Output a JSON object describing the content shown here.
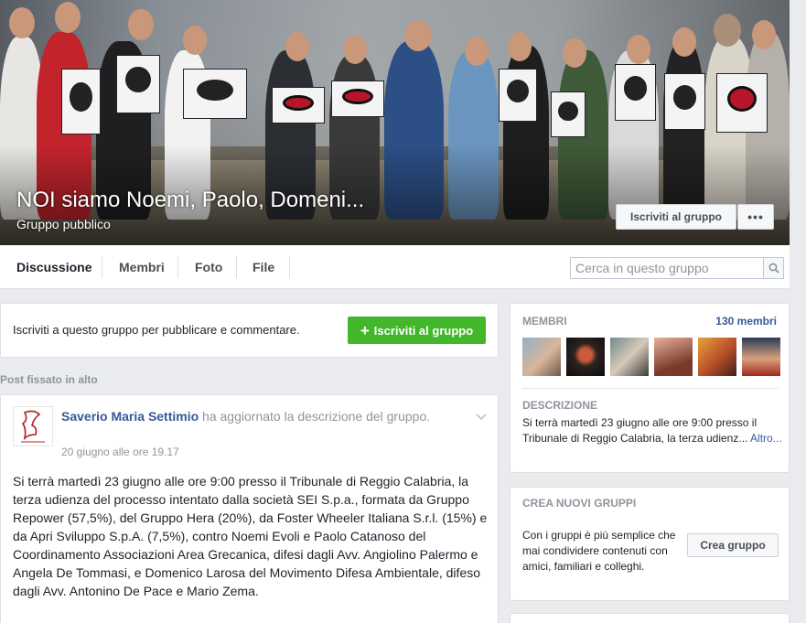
{
  "group": {
    "title": "NOI siamo Noemi, Paolo, Domeni...",
    "privacy": "Gruppo pubblico",
    "join_label": "Iscriviti al gruppo",
    "more_label": "•••"
  },
  "nav": {
    "tabs": [
      {
        "label": "Discussione",
        "active": true
      },
      {
        "label": "Membri"
      },
      {
        "label": "Foto"
      },
      {
        "label": "File"
      }
    ],
    "search_placeholder": "Cerca in questo gruppo"
  },
  "join_prompt": {
    "text": "Iscriviti a questo gruppo per pubblicare e commentare.",
    "button_label": "Iscriviti al gruppo"
  },
  "pinned_label": "Post fissato in alto",
  "post": {
    "author": "Saverio Maria Settimio",
    "action": " ha aggiornato la descrizione del gruppo.",
    "time": "20 giugno alle ore 19.17",
    "body": "Si terrà martedì 23 giugno alle ore 9:00 presso il Tribunale di Reggio Calabria, la terza udienza del processo intentato dalla società SEI S.p.a., formata da Gruppo Repower (57,5%), del Gruppo Hera (20%), da Foster Wheeler Italiana S.r.l. (15%) e da Apri Sviluppo S.p.A. (7,5%), contro Noemi Evoli e Paolo Catanoso del Coordinamento Associazioni Area Grecanica, difesi dagli Avv. Angiolino Palermo e Angela De Tommasi, e Domenico Larosa del Movimento Difesa Ambientale, difeso dagli Avv. Antonino De Pace e Mario Zema."
  },
  "sidebar": {
    "members_heading": "Membri",
    "members_count": "130 membri",
    "description_heading": "Descrizione",
    "description_text": "Si terrà martedì 23 giugno alle ore 9:00 presso il Tribunale di Reggio Calabria, la terza udienz...",
    "description_more": "Altro...",
    "create_heading": "Crea nuovi gruppi",
    "create_text": "Con i gruppi è più semplice che mai condividere contenuti con amici, familiari e colleghi.",
    "create_button": "Crea gruppo"
  },
  "colors": {
    "link": "#365899",
    "join_green": "#42b72a",
    "background": "#e9ebee"
  }
}
